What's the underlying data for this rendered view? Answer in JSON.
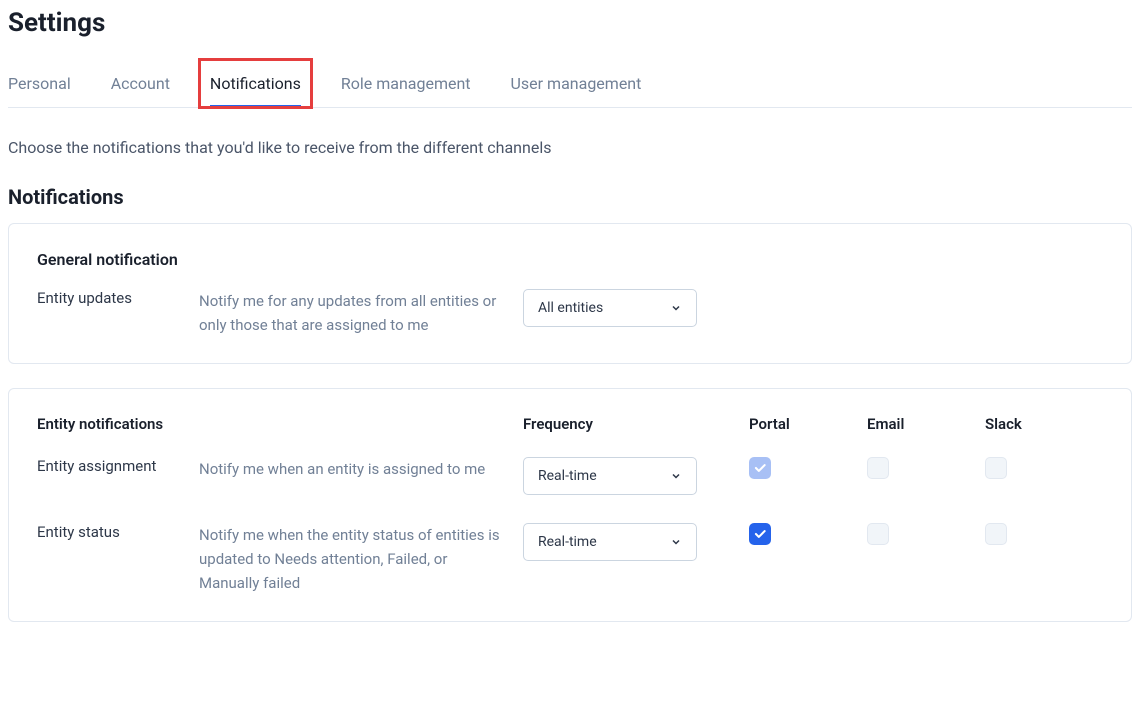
{
  "page": {
    "title": "Settings",
    "intro": "Choose the notifications that you'd like to receive from the different channels",
    "section_title": "Notifications"
  },
  "tabs": [
    {
      "label": "Personal",
      "active": false
    },
    {
      "label": "Account",
      "active": false
    },
    {
      "label": "Notifications",
      "active": true
    },
    {
      "label": "Role management",
      "active": false
    },
    {
      "label": "User management",
      "active": false
    }
  ],
  "general": {
    "heading": "General notification",
    "row": {
      "name": "Entity updates",
      "desc": "Notify me for any updates from all entities or only those that are assigned to me",
      "select_value": "All entities"
    }
  },
  "entity": {
    "heading": "Entity notifications",
    "columns": {
      "frequency": "Frequency",
      "portal": "Portal",
      "email": "Email",
      "slack": "Slack"
    },
    "rows": [
      {
        "name": "Entity assignment",
        "desc": "Notify me when an entity is assigned to me",
        "select_value": "Real-time",
        "portal": {
          "checked": true,
          "disabled": true
        },
        "email": {
          "checked": false
        },
        "slack": {
          "checked": false
        }
      },
      {
        "name": "Entity status",
        "desc": "Notify me when the entity status of entities is updated to Needs attention, Failed, or Manually failed",
        "select_value": "Real-time",
        "portal": {
          "checked": true,
          "disabled": false
        },
        "email": {
          "checked": false
        },
        "slack": {
          "checked": false
        }
      }
    ]
  }
}
